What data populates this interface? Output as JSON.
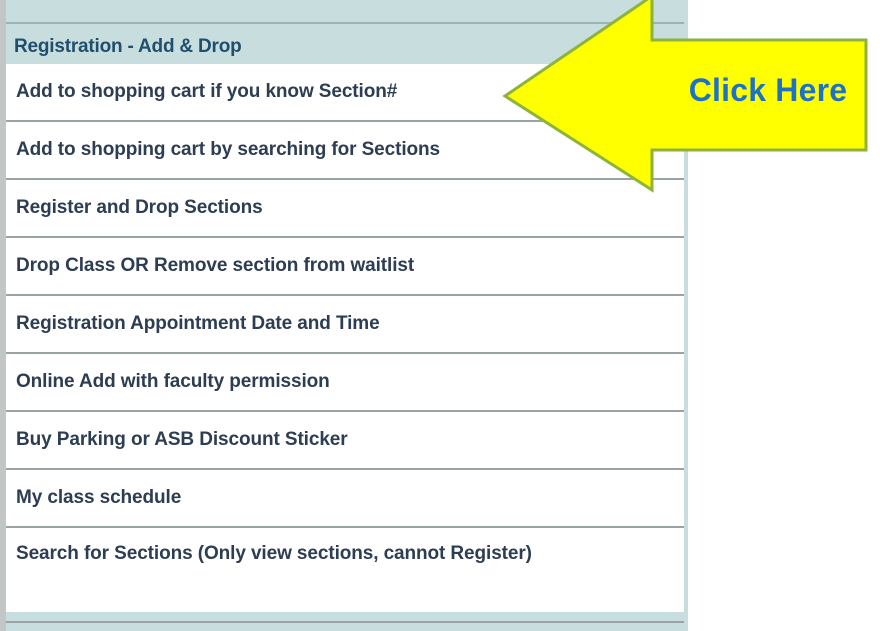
{
  "section": {
    "title": "Registration - Add & Drop"
  },
  "menu": {
    "items": [
      {
        "label": "Add to shopping cart if you know Section#"
      },
      {
        "label": "Add to shopping cart by searching for Sections"
      },
      {
        "label": "Register and Drop Sections"
      },
      {
        "label": "Drop Class OR Remove section from waitlist"
      },
      {
        "label": "Registration Appointment Date and Time"
      },
      {
        "label": "Online Add with faculty permission"
      },
      {
        "label": "Buy Parking or ASB Discount Sticker"
      },
      {
        "label": "My class schedule"
      },
      {
        "label": "Search for Sections (Only view sections, cannot Register)"
      }
    ]
  },
  "callout": {
    "label": "Click Here",
    "fill_color": "#ffff00",
    "stroke_color": "#8db33b",
    "text_color": "#1d72c8"
  },
  "colors": {
    "panel_background": "#c8dede",
    "header_text": "#1f4f6d",
    "item_text": "#2d3d52"
  }
}
